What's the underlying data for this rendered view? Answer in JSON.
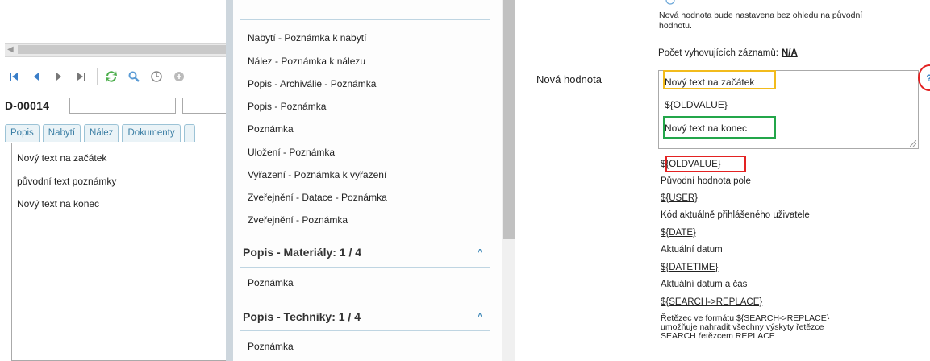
{
  "left_panel": {
    "record_code": "D-00014",
    "tabs": [
      "Popis",
      "Nabytí",
      "Nález",
      "Dokumenty"
    ],
    "content_lines": [
      "Nový text na začátek",
      "původní text poznámky",
      "Nový text na konec"
    ]
  },
  "middle_panel": {
    "groups": [
      {
        "title": "Popis - Materiály: 1 / 4",
        "items": [
          "Poznámka"
        ]
      },
      {
        "title": "Popis - Techniky: 1 / 4",
        "items": [
          "Poznámka"
        ]
      }
    ],
    "top_items": [
      "Nabytí - Poznámka k nabytí",
      "Nález - Poznámka k nálezu",
      "Popis - Archiválie - Poznámka",
      "Popis - Poznámka",
      "Poznámka",
      "Uložení - Poznámka",
      "Vyřazení - Poznámka k vyřazení",
      "Zveřejnění - Datace - Poznámka",
      "Zveřejnění - Poznámka"
    ]
  },
  "right_panel": {
    "info_line1": "Nová hodnota bude nastavena bez ohledu na původní",
    "info_line2": "hodnotu.",
    "count_label": "Počet vyhovujících záznamů:",
    "count_value": "N/A",
    "new_value_label": "Nová hodnota",
    "textarea_lines": [
      "Nový text na začátek",
      "${OLDVALUE}",
      "Nový text na konec"
    ],
    "help": "?",
    "variables": [
      {
        "name": "${OLDVALUE}",
        "desc": "Původní hodnota pole"
      },
      {
        "name": "${USER}",
        "desc": "Kód aktuálně přihlášeného uživatele"
      },
      {
        "name": "${DATE}",
        "desc": "Aktuální datum"
      },
      {
        "name": "${DATETIME}",
        "desc": "Aktuální datum a čas"
      },
      {
        "name": "${SEARCH->REPLACE}",
        "desc": "Řetězec ve formátu ${SEARCH->REPLACE} umožňuje nahradit všechny výskyty řetězce SEARCH řetězcem REPLACE"
      }
    ]
  },
  "colors": {
    "accent": "#3a86b6",
    "highlight_yellow": "#f2bb1c",
    "highlight_green": "#23a64a",
    "highlight_red": "#e32222"
  }
}
